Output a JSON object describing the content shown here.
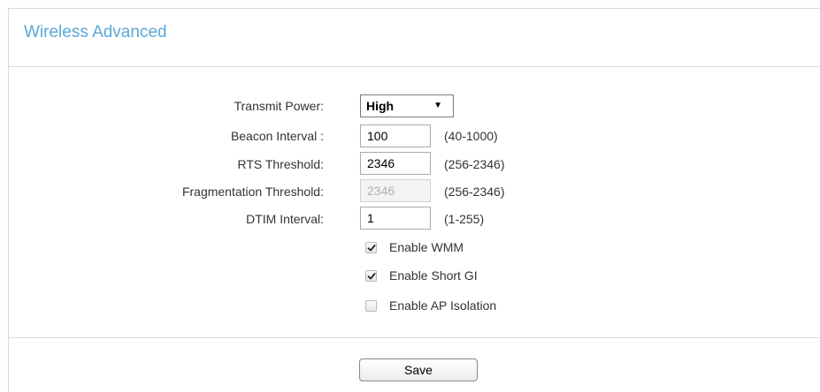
{
  "page": {
    "title": "Wireless Advanced"
  },
  "form": {
    "transmit_power": {
      "label": "Transmit Power:",
      "selected": "High",
      "options": [
        "High"
      ]
    },
    "beacon_interval": {
      "label": "Beacon Interval :",
      "value": "100",
      "range": "(40-1000)"
    },
    "rts_threshold": {
      "label": "RTS Threshold:",
      "value": "2346",
      "range": "(256-2346)"
    },
    "fragmentation_threshold": {
      "label": "Fragmentation Threshold:",
      "value": "2346",
      "range": "(256-2346)",
      "disabled": true
    },
    "dtim_interval": {
      "label": "DTIM Interval:",
      "value": "1",
      "range": "(1-255)"
    },
    "enable_wmm": {
      "label": "Enable WMM",
      "checked": true
    },
    "enable_short_gi": {
      "label": "Enable Short GI",
      "checked": true
    },
    "enable_ap_isolation": {
      "label": "Enable AP Isolation",
      "checked": false
    }
  },
  "actions": {
    "save_label": "Save"
  },
  "colors": {
    "title": "#5aa8d8",
    "divider": "#d9d9d9",
    "text": "#333333"
  },
  "icons": {
    "dropdown": "triangle-down-icon",
    "check": "checkmark-icon"
  }
}
